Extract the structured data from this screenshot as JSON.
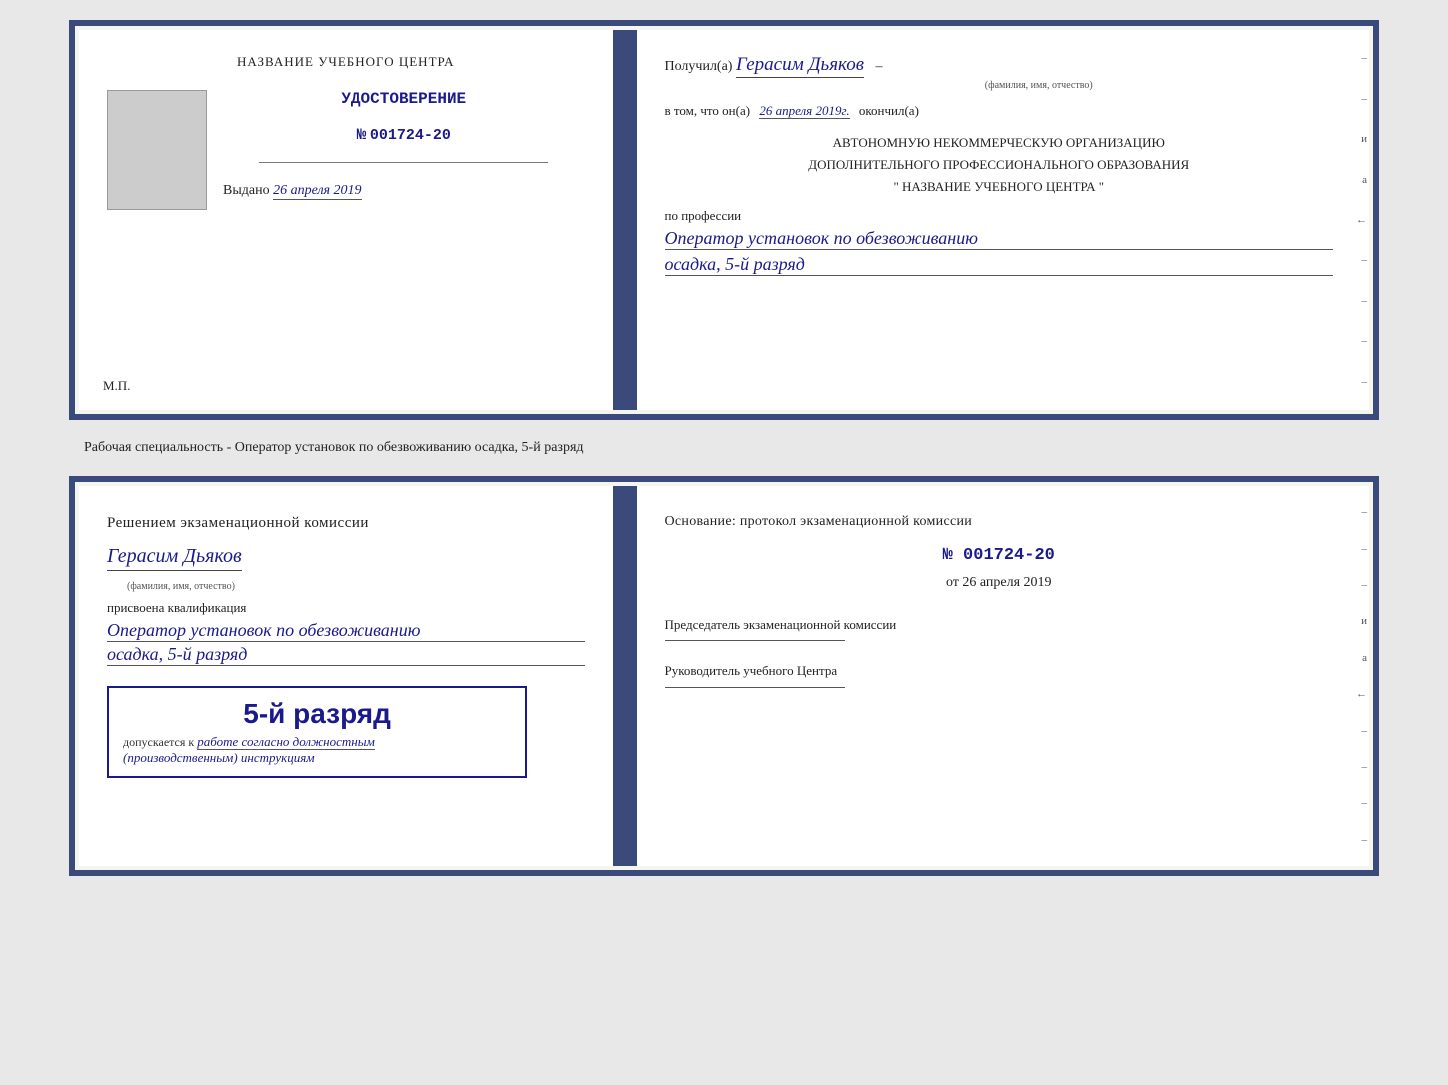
{
  "top_document": {
    "left": {
      "center_title": "НАЗВАНИЕ УЧЕБНОГО ЦЕНТРА",
      "udostoverenie_label": "УДОСТОВЕРЕНИЕ",
      "number_prefix": "№",
      "number_value": "001724-20",
      "issued_label": "Выдано",
      "issued_date": "26 апреля 2019",
      "mp_label": "М.П."
    },
    "right": {
      "poluchil_label": "Получил(а)",
      "recipient_name": "Герасим Дьяков",
      "fio_sublabel": "(фамилия, имя, отчество)",
      "dash": "–",
      "vtom_label": "в том, что он(а)",
      "date_value": "26 апреля 2019г.",
      "okonchil_label": "окончил(а)",
      "org_line1": "АВТОНОМНУЮ НЕКОММЕРЧЕСКУЮ ОРГАНИЗАЦИЮ",
      "org_line2": "ДОПОЛНИТЕЛЬНОГО ПРОФЕССИОНАЛЬНОГО ОБРАЗОВАНИЯ",
      "org_quotes": "\"",
      "org_name_center": "НАЗВАНИЕ УЧЕБНОГО ЦЕНТРА",
      "po_professii": "по профессии",
      "profession_value": "Оператор установок по обезвоживанию",
      "rank_value": "осадка, 5-й разряд",
      "side_marks": [
        "–",
        "–",
        "и",
        "а",
        "←",
        "–",
        "–",
        "–",
        "–"
      ]
    }
  },
  "separator": {
    "text": "Рабочая специальность - Оператор установок по обезвоживанию осадка, 5-й разряд"
  },
  "bottom_document": {
    "left": {
      "decision_text": "Решением экзаменационной комиссии",
      "person_name": "Герасим Дьяков",
      "fio_sublabel": "(фамилия, имя, отчество)",
      "prisvoena": "присвоена квалификация",
      "qual_line1": "Оператор установок по обезвоживанию",
      "qual_line2": "осадка, 5-й разряд",
      "rank_box_title": "5-й разряд",
      "dopuskaetsya": "допускается к",
      "work_text": "работе согласно должностным",
      "instr_text": "(производственным) инструкциям"
    },
    "right": {
      "osnovanye_label": "Основание: протокол экзаменационной комиссии",
      "protocol_number": "№ 001724-20",
      "ot_label": "от",
      "date_value": "26 апреля 2019",
      "predsedatel_label": "Председатель экзаменационной комиссии",
      "rukovoditel_label": "Руководитель учебного Центра",
      "side_marks": [
        "–",
        "–",
        "–",
        "и",
        "а",
        "←",
        "–",
        "–",
        "–",
        "–"
      ]
    }
  }
}
